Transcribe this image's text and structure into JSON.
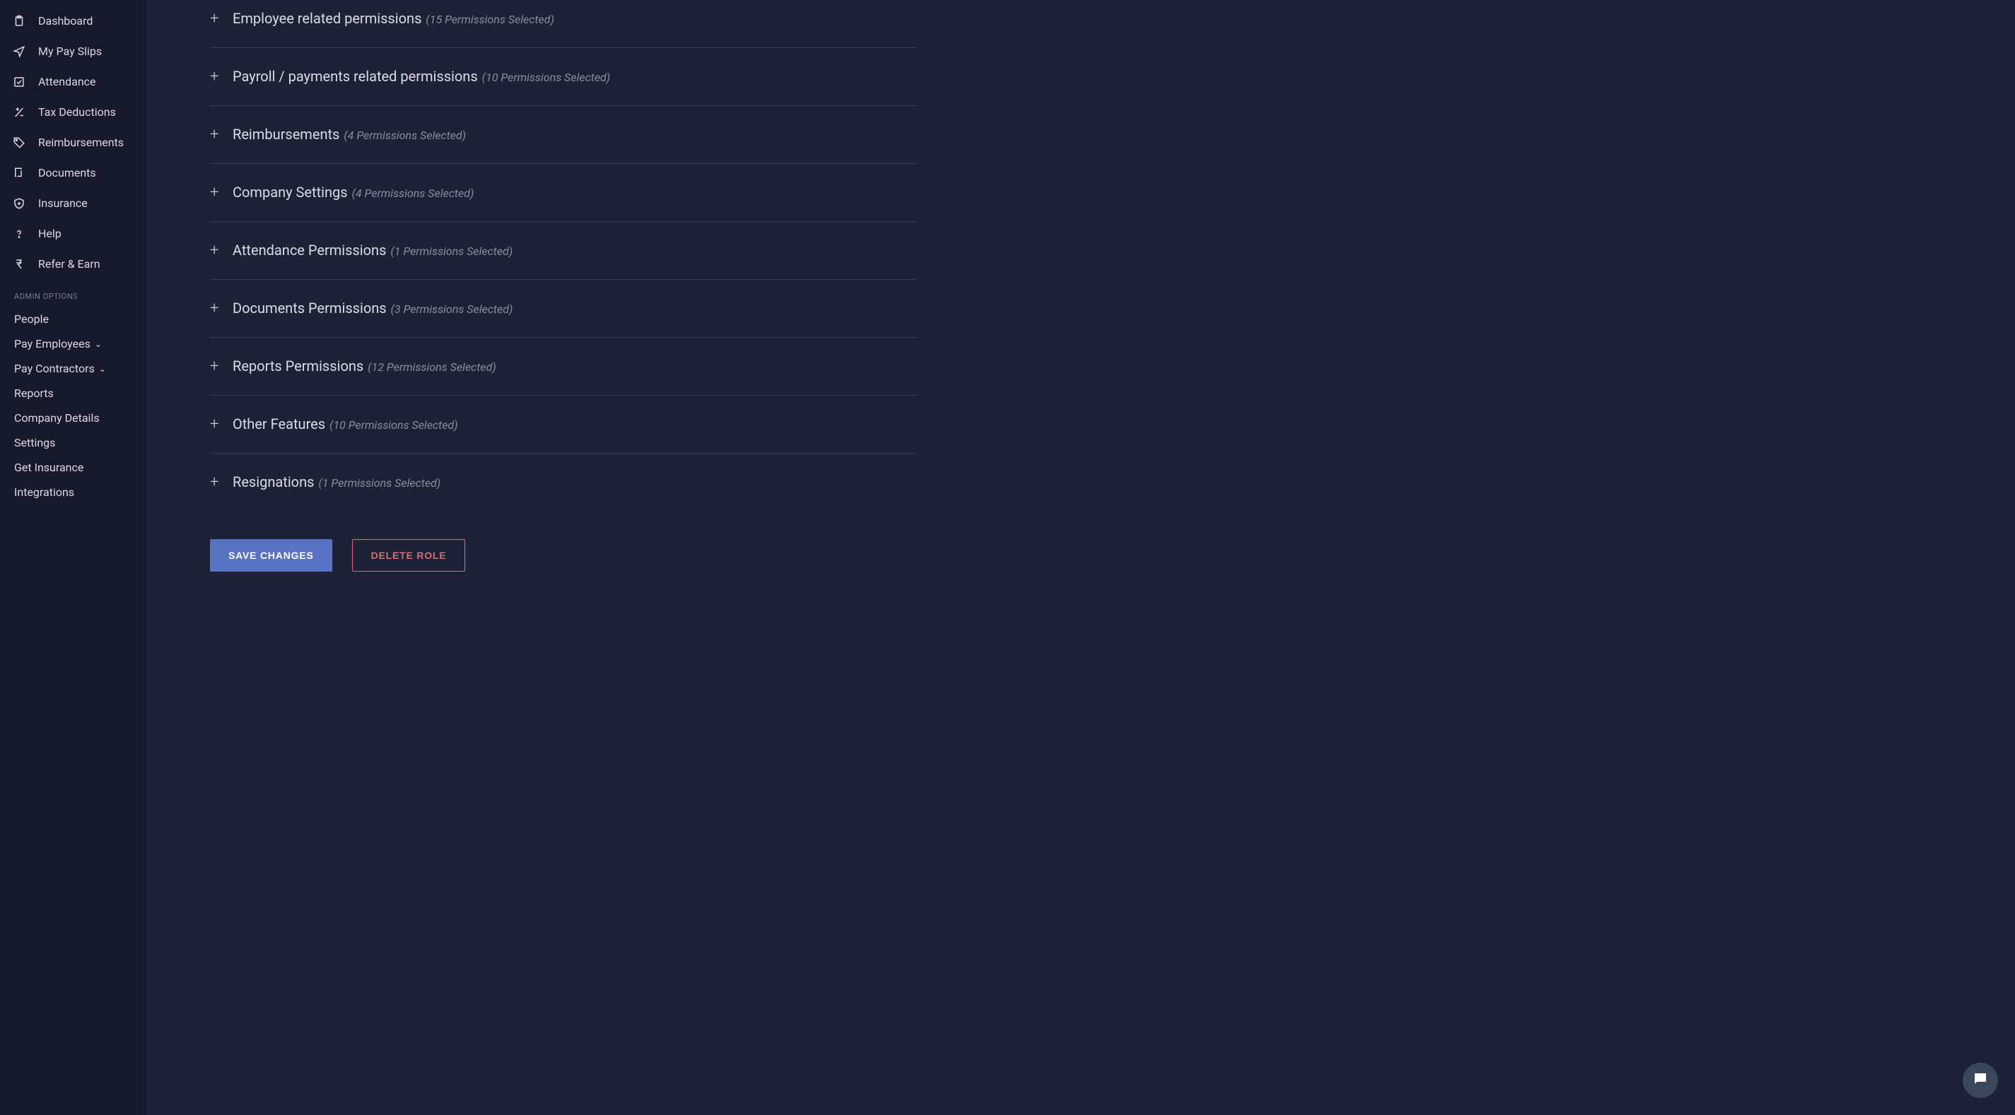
{
  "sidebar": {
    "items": [
      {
        "label": "Dashboard"
      },
      {
        "label": "My Pay Slips"
      },
      {
        "label": "Attendance"
      },
      {
        "label": "Tax Deductions"
      },
      {
        "label": "Reimbursements"
      },
      {
        "label": "Documents"
      },
      {
        "label": "Insurance"
      },
      {
        "label": "Help"
      },
      {
        "label": "Refer & Earn"
      }
    ],
    "admin_header": "ADMIN OPTIONS",
    "admin_links": [
      {
        "label": "People"
      },
      {
        "label": "Pay Employees",
        "has_chevron": true
      },
      {
        "label": "Pay Contractors",
        "has_chevron": true
      },
      {
        "label": "Reports"
      },
      {
        "label": "Company Details"
      },
      {
        "label": "Settings"
      },
      {
        "label": "Get Insurance"
      },
      {
        "label": "Integrations"
      }
    ]
  },
  "permissions": [
    {
      "title": "Employee related permissions",
      "count_label": "(15 Permissions Selected)"
    },
    {
      "title": "Payroll / payments related permissions",
      "count_label": "(10 Permissions Selected)"
    },
    {
      "title": "Reimbursements",
      "count_label": "(4 Permissions Selected)"
    },
    {
      "title": "Company Settings",
      "count_label": "(4 Permissions Selected)"
    },
    {
      "title": "Attendance Permissions",
      "count_label": "(1 Permissions Selected)"
    },
    {
      "title": "Documents Permissions",
      "count_label": "(3 Permissions Selected)"
    },
    {
      "title": "Reports Permissions",
      "count_label": "(12 Permissions Selected)"
    },
    {
      "title": "Other Features",
      "count_label": "(10 Permissions Selected)"
    },
    {
      "title": "Resignations",
      "count_label": "(1 Permissions Selected)"
    }
  ],
  "actions": {
    "save": "SAVE CHANGES",
    "delete": "DELETE ROLE"
  }
}
